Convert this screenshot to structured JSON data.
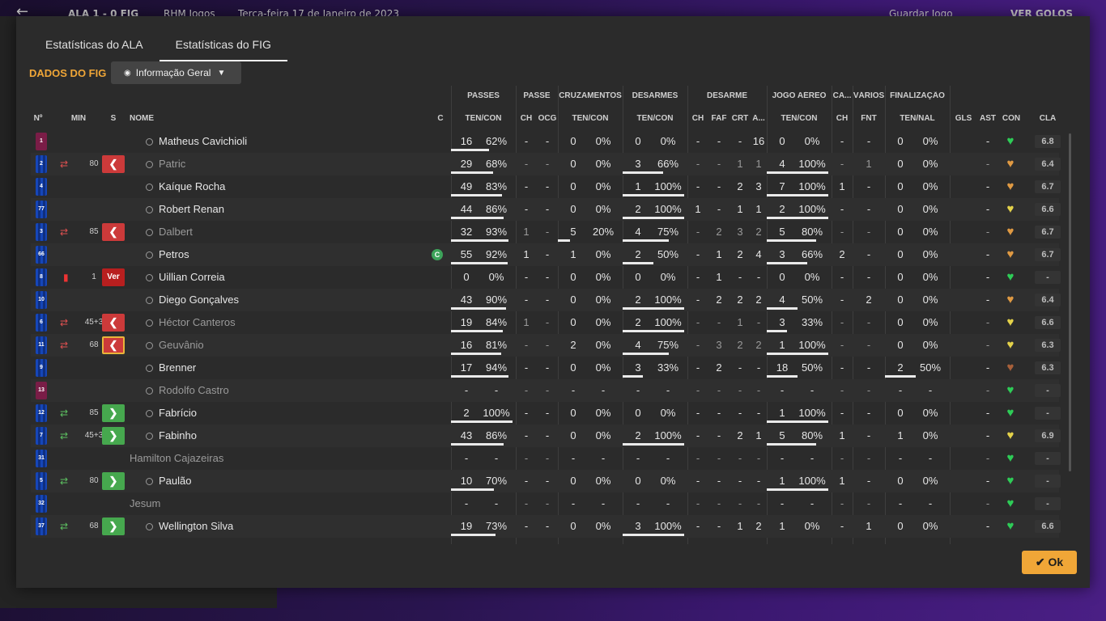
{
  "background": {
    "back_icon": "←",
    "score": "ALA  1 - 0  FIG",
    "venue": "RHM Jogos",
    "date": "Terça-feira 17 de Janeiro de 2023",
    "save_button": "Guardar Jogo",
    "goals_button": "VER GOLOS"
  },
  "tabs": [
    "Estatísticas do ALA",
    "Estatísticas do FIG"
  ],
  "section_title": "DADOS DO FIG",
  "view_dropdown": {
    "label": "Informação Geral"
  },
  "group_headers": {
    "passes": "PASSES",
    "passe": "PASSE",
    "cruzamentos": "CRUZAMENTOS",
    "desarmes": "DESARMES",
    "desarme": "DESARME",
    "jogo_aereo": "JOGO AÉREO",
    "ca": "CA...",
    "varios": "VÁRIOS",
    "finalizacao": "FINALIZAÇÃO"
  },
  "column_headers": {
    "num": "Nº",
    "min": "MIN",
    "s": "S",
    "nome": "NOME",
    "c": "C",
    "passes_tc": "TEN/CON",
    "passe_ch": "CH",
    "passe_ocg": "OCG",
    "cruz_tc": "TEN/CON",
    "des_tc": "TEN/CON",
    "d_ch": "CH",
    "d_faf": "FAF",
    "d_crt": "CRT",
    "d_a": "A...",
    "aer_tc": "TEN/CON",
    "ca_ch": "CH",
    "var_fnt": "FNT",
    "fin_tn": "TEN/NAL",
    "gls": "GLS",
    "ast": "AST",
    "con": "CON",
    "cla": "CLA"
  },
  "colors": {
    "accent": "#f0a637",
    "red": "#cc3a3a",
    "green": "#46a84e",
    "green_heart": "#2ecc57",
    "yellow_heart": "#e4d24a",
    "orange_heart": "#e09a43",
    "brown_heart": "#a8603a"
  },
  "players": [
    {
      "num": "1",
      "shirt": "gk",
      "sub_icon": "",
      "min": "",
      "s_btn": "",
      "name": "Matheus Cavichioli",
      "dim": false,
      "captain": false,
      "p_ten": "16",
      "p_pct": "62%",
      "ps_ch": "-",
      "ps_ocg": "-",
      "cr_ten": "0",
      "cr_pct": "0%",
      "de_ten": "0",
      "de_pct": "0%",
      "d_ch": "-",
      "d_faf": "-",
      "d_crt": "-",
      "d_a": "16",
      "ae_ten": "0",
      "ae_pct": "0%",
      "ca_ch": "-",
      "var_fnt": "-",
      "fi_ten": "0",
      "fi_pct": "0%",
      "gls": "",
      "ast": "-",
      "heart": "green",
      "rating": "6.8"
    },
    {
      "num": "2",
      "shirt": "out",
      "sub_icon": "off",
      "min": "80",
      "s_btn": "red",
      "name": "Patric",
      "dim": true,
      "captain": false,
      "p_ten": "29",
      "p_pct": "68%",
      "ps_ch": "-",
      "ps_ocg": "-",
      "cr_ten": "0",
      "cr_pct": "0%",
      "de_ten": "3",
      "de_pct": "66%",
      "d_ch": "-",
      "d_faf": "-",
      "d_crt": "1",
      "d_a": "1",
      "ae_ten": "4",
      "ae_pct": "100%",
      "ca_ch": "-",
      "var_fnt": "1",
      "fi_ten": "0",
      "fi_pct": "0%",
      "gls": "",
      "ast": "-",
      "heart": "orange",
      "rating": "6.4"
    },
    {
      "num": "4",
      "shirt": "out",
      "sub_icon": "",
      "min": "",
      "s_btn": "",
      "name": "Kaíque Rocha",
      "dim": false,
      "captain": false,
      "p_ten": "49",
      "p_pct": "83%",
      "ps_ch": "-",
      "ps_ocg": "-",
      "cr_ten": "0",
      "cr_pct": "0%",
      "de_ten": "1",
      "de_pct": "100%",
      "d_ch": "-",
      "d_faf": "-",
      "d_crt": "2",
      "d_a": "3",
      "ae_ten": "7",
      "ae_pct": "100%",
      "ca_ch": "1",
      "var_fnt": "-",
      "fi_ten": "0",
      "fi_pct": "0%",
      "gls": "",
      "ast": "-",
      "heart": "orange",
      "rating": "6.7"
    },
    {
      "num": "77",
      "shirt": "out",
      "sub_icon": "",
      "min": "",
      "s_btn": "",
      "name": "Robert Renan",
      "dim": false,
      "captain": false,
      "p_ten": "44",
      "p_pct": "86%",
      "ps_ch": "-",
      "ps_ocg": "-",
      "cr_ten": "0",
      "cr_pct": "0%",
      "de_ten": "2",
      "de_pct": "100%",
      "d_ch": "1",
      "d_faf": "-",
      "d_crt": "1",
      "d_a": "1",
      "ae_ten": "2",
      "ae_pct": "100%",
      "ca_ch": "-",
      "var_fnt": "-",
      "fi_ten": "0",
      "fi_pct": "0%",
      "gls": "",
      "ast": "-",
      "heart": "yellow",
      "rating": "6.6"
    },
    {
      "num": "3",
      "shirt": "out",
      "sub_icon": "off",
      "min": "85",
      "s_btn": "red",
      "name": "Dalbert",
      "dim": true,
      "captain": false,
      "p_ten": "32",
      "p_pct": "93%",
      "ps_ch": "1",
      "ps_ocg": "-",
      "cr_ten": "5",
      "cr_pct": "20%",
      "de_ten": "4",
      "de_pct": "75%",
      "d_ch": "-",
      "d_faf": "2",
      "d_crt": "3",
      "d_a": "2",
      "ae_ten": "5",
      "ae_pct": "80%",
      "ca_ch": "-",
      "var_fnt": "-",
      "fi_ten": "0",
      "fi_pct": "0%",
      "gls": "",
      "ast": "-",
      "heart": "orange",
      "rating": "6.7"
    },
    {
      "num": "66",
      "shirt": "out",
      "sub_icon": "",
      "min": "",
      "s_btn": "",
      "name": "Petros",
      "dim": false,
      "captain": true,
      "p_ten": "55",
      "p_pct": "92%",
      "ps_ch": "1",
      "ps_ocg": "-",
      "cr_ten": "1",
      "cr_pct": "0%",
      "de_ten": "2",
      "de_pct": "50%",
      "d_ch": "-",
      "d_faf": "1",
      "d_crt": "2",
      "d_a": "4",
      "ae_ten": "3",
      "ae_pct": "66%",
      "ca_ch": "2",
      "var_fnt": "-",
      "fi_ten": "0",
      "fi_pct": "0%",
      "gls": "",
      "ast": "-",
      "heart": "orange",
      "rating": "6.7"
    },
    {
      "num": "8",
      "shirt": "out",
      "sub_icon": "card",
      "min": "1",
      "s_btn": "ver",
      "name": "Uillian Correia",
      "dim": false,
      "captain": false,
      "p_ten": "0",
      "p_pct": "0%",
      "ps_ch": "-",
      "ps_ocg": "-",
      "cr_ten": "0",
      "cr_pct": "0%",
      "de_ten": "0",
      "de_pct": "0%",
      "d_ch": "-",
      "d_faf": "1",
      "d_crt": "-",
      "d_a": "-",
      "ae_ten": "0",
      "ae_pct": "0%",
      "ca_ch": "-",
      "var_fnt": "-",
      "fi_ten": "0",
      "fi_pct": "0%",
      "gls": "",
      "ast": "-",
      "heart": "green",
      "rating": "-"
    },
    {
      "num": "10",
      "shirt": "out",
      "sub_icon": "",
      "min": "",
      "s_btn": "",
      "name": "Diego Gonçalves",
      "dim": false,
      "captain": false,
      "p_ten": "43",
      "p_pct": "90%",
      "ps_ch": "-",
      "ps_ocg": "-",
      "cr_ten": "0",
      "cr_pct": "0%",
      "de_ten": "2",
      "de_pct": "100%",
      "d_ch": "-",
      "d_faf": "2",
      "d_crt": "2",
      "d_a": "2",
      "ae_ten": "4",
      "ae_pct": "50%",
      "ca_ch": "-",
      "var_fnt": "2",
      "fi_ten": "0",
      "fi_pct": "0%",
      "gls": "",
      "ast": "-",
      "heart": "orange",
      "rating": "6.4"
    },
    {
      "num": "6",
      "shirt": "out",
      "sub_icon": "off",
      "min": "45+3",
      "s_btn": "red",
      "name": "Héctor Canteros",
      "dim": true,
      "captain": false,
      "p_ten": "19",
      "p_pct": "84%",
      "ps_ch": "1",
      "ps_ocg": "-",
      "cr_ten": "0",
      "cr_pct": "0%",
      "de_ten": "2",
      "de_pct": "100%",
      "d_ch": "-",
      "d_faf": "-",
      "d_crt": "1",
      "d_a": "-",
      "ae_ten": "3",
      "ae_pct": "33%",
      "ca_ch": "-",
      "var_fnt": "-",
      "fi_ten": "0",
      "fi_pct": "0%",
      "gls": "",
      "ast": "-",
      "heart": "yellow",
      "rating": "6.6"
    },
    {
      "num": "11",
      "shirt": "out",
      "sub_icon": "off",
      "min": "68",
      "s_btn": "red-sel",
      "name": "Geuvânio",
      "dim": true,
      "captain": false,
      "p_ten": "16",
      "p_pct": "81%",
      "ps_ch": "-",
      "ps_ocg": "-",
      "cr_ten": "2",
      "cr_pct": "0%",
      "de_ten": "4",
      "de_pct": "75%",
      "d_ch": "-",
      "d_faf": "3",
      "d_crt": "2",
      "d_a": "2",
      "ae_ten": "1",
      "ae_pct": "100%",
      "ca_ch": "-",
      "var_fnt": "-",
      "fi_ten": "0",
      "fi_pct": "0%",
      "gls": "",
      "ast": "-",
      "heart": "yellow",
      "rating": "6.3"
    },
    {
      "num": "9",
      "shirt": "out",
      "sub_icon": "",
      "min": "",
      "s_btn": "",
      "name": "Brenner",
      "dim": false,
      "captain": false,
      "p_ten": "17",
      "p_pct": "94%",
      "ps_ch": "-",
      "ps_ocg": "-",
      "cr_ten": "0",
      "cr_pct": "0%",
      "de_ten": "3",
      "de_pct": "33%",
      "d_ch": "-",
      "d_faf": "2",
      "d_crt": "-",
      "d_a": "-",
      "ae_ten": "18",
      "ae_pct": "50%",
      "ca_ch": "-",
      "var_fnt": "-",
      "fi_ten": "2",
      "fi_pct": "50%",
      "gls": "",
      "ast": "-",
      "heart": "brown",
      "rating": "6.3"
    },
    {
      "num": "13",
      "shirt": "gk",
      "sub_icon": "",
      "min": "",
      "s_btn": "",
      "name": "Rodolfo Castro",
      "dim": true,
      "captain": false,
      "p_ten": "-",
      "p_pct": "-",
      "ps_ch": "-",
      "ps_ocg": "-",
      "cr_ten": "-",
      "cr_pct": "-",
      "de_ten": "-",
      "de_pct": "-",
      "d_ch": "-",
      "d_faf": "-",
      "d_crt": "-",
      "d_a": "-",
      "ae_ten": "-",
      "ae_pct": "-",
      "ca_ch": "-",
      "var_fnt": "-",
      "fi_ten": "-",
      "fi_pct": "-",
      "gls": "",
      "ast": "-",
      "heart": "green",
      "rating": "-"
    },
    {
      "num": "12",
      "shirt": "out",
      "sub_icon": "on",
      "min": "85",
      "s_btn": "green",
      "name": "Fabrício",
      "dim": false,
      "captain": false,
      "p_ten": "2",
      "p_pct": "100%",
      "ps_ch": "-",
      "ps_ocg": "-",
      "cr_ten": "0",
      "cr_pct": "0%",
      "de_ten": "0",
      "de_pct": "0%",
      "d_ch": "-",
      "d_faf": "-",
      "d_crt": "-",
      "d_a": "-",
      "ae_ten": "1",
      "ae_pct": "100%",
      "ca_ch": "-",
      "var_fnt": "-",
      "fi_ten": "0",
      "fi_pct": "0%",
      "gls": "",
      "ast": "-",
      "heart": "green",
      "rating": "-"
    },
    {
      "num": "7",
      "shirt": "out",
      "sub_icon": "on",
      "min": "45+3",
      "s_btn": "green",
      "name": "Fabinho",
      "dim": false,
      "captain": false,
      "p_ten": "43",
      "p_pct": "86%",
      "ps_ch": "-",
      "ps_ocg": "-",
      "cr_ten": "0",
      "cr_pct": "0%",
      "de_ten": "2",
      "de_pct": "100%",
      "d_ch": "-",
      "d_faf": "-",
      "d_crt": "2",
      "d_a": "1",
      "ae_ten": "5",
      "ae_pct": "80%",
      "ca_ch": "1",
      "var_fnt": "-",
      "fi_ten": "1",
      "fi_pct": "0%",
      "gls": "",
      "ast": "-",
      "heart": "yellow",
      "rating": "6.9"
    },
    {
      "num": "31",
      "shirt": "out",
      "sub_icon": "",
      "min": "",
      "s_btn": "",
      "name": "Hamilton Cajazeiras",
      "dim": true,
      "captain": false,
      "no_bust": true,
      "p_ten": "-",
      "p_pct": "-",
      "ps_ch": "-",
      "ps_ocg": "-",
      "cr_ten": "-",
      "cr_pct": "-",
      "de_ten": "-",
      "de_pct": "-",
      "d_ch": "-",
      "d_faf": "-",
      "d_crt": "-",
      "d_a": "-",
      "ae_ten": "-",
      "ae_pct": "-",
      "ca_ch": "-",
      "var_fnt": "-",
      "fi_ten": "-",
      "fi_pct": "-",
      "gls": "",
      "ast": "-",
      "heart": "green",
      "rating": "-"
    },
    {
      "num": "5",
      "shirt": "out",
      "sub_icon": "on",
      "min": "80",
      "s_btn": "green",
      "name": "Paulão",
      "dim": false,
      "captain": false,
      "p_ten": "10",
      "p_pct": "70%",
      "ps_ch": "-",
      "ps_ocg": "-",
      "cr_ten": "0",
      "cr_pct": "0%",
      "de_ten": "0",
      "de_pct": "0%",
      "d_ch": "-",
      "d_faf": "-",
      "d_crt": "-",
      "d_a": "-",
      "ae_ten": "1",
      "ae_pct": "100%",
      "ca_ch": "1",
      "var_fnt": "-",
      "fi_ten": "0",
      "fi_pct": "0%",
      "gls": "",
      "ast": "-",
      "heart": "green",
      "rating": "-"
    },
    {
      "num": "32",
      "shirt": "out",
      "sub_icon": "",
      "min": "",
      "s_btn": "",
      "name": "Jesum",
      "dim": true,
      "captain": false,
      "no_bust": true,
      "p_ten": "-",
      "p_pct": "-",
      "ps_ch": "-",
      "ps_ocg": "-",
      "cr_ten": "-",
      "cr_pct": "-",
      "de_ten": "-",
      "de_pct": "-",
      "d_ch": "-",
      "d_faf": "-",
      "d_crt": "-",
      "d_a": "-",
      "ae_ten": "-",
      "ae_pct": "-",
      "ca_ch": "-",
      "var_fnt": "-",
      "fi_ten": "-",
      "fi_pct": "-",
      "gls": "",
      "ast": "-",
      "heart": "green",
      "rating": "-"
    },
    {
      "num": "37",
      "shirt": "out",
      "sub_icon": "on",
      "min": "68",
      "s_btn": "green",
      "name": "Wellington Silva",
      "dim": false,
      "captain": false,
      "p_ten": "19",
      "p_pct": "73%",
      "ps_ch": "-",
      "ps_ocg": "-",
      "cr_ten": "0",
      "cr_pct": "0%",
      "de_ten": "3",
      "de_pct": "100%",
      "d_ch": "-",
      "d_faf": "-",
      "d_crt": "1",
      "d_a": "2",
      "ae_ten": "1",
      "ae_pct": "0%",
      "ca_ch": "-",
      "var_fnt": "1",
      "fi_ten": "0",
      "fi_pct": "0%",
      "gls": "",
      "ast": "-",
      "heart": "green",
      "rating": "6.6"
    }
  ],
  "ok_button": "Ok"
}
